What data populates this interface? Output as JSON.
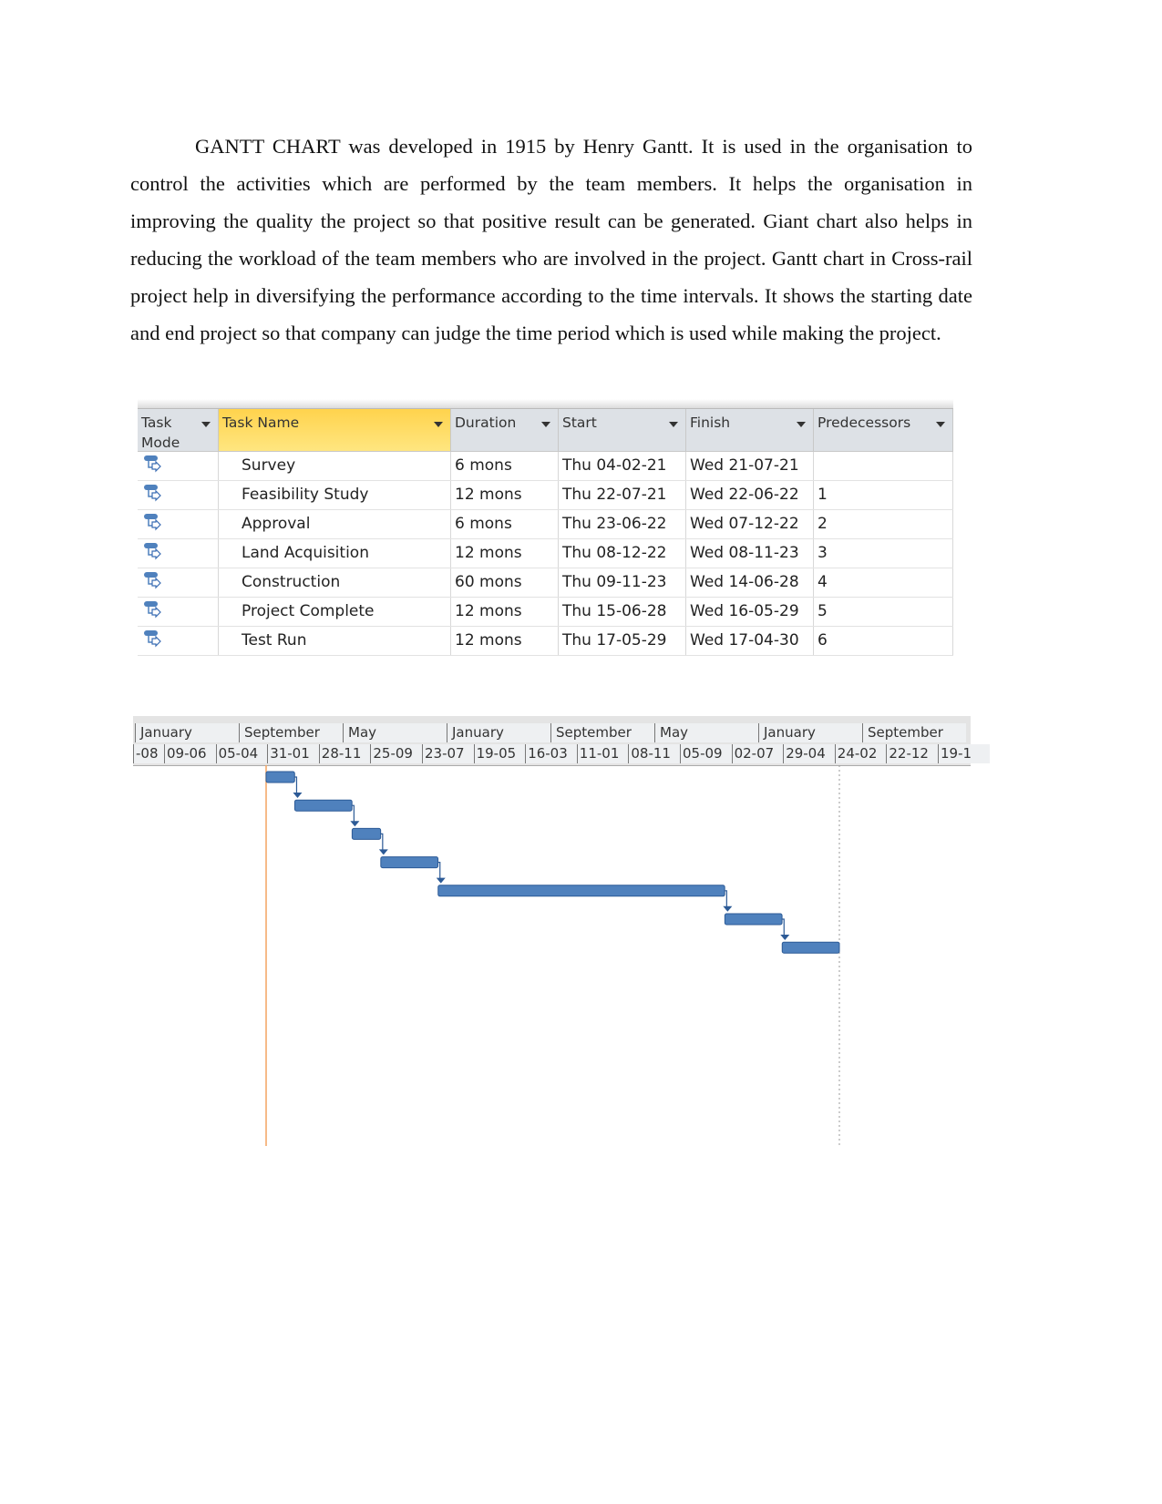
{
  "paragraph": "GANTT CHART was developed in 1915 by Henry Gantt. It is used in the organisation to control the activities which are performed by the team members. It helps the organisation in improving the quality the project so that positive result can be generated. Giant chart also helps in reducing the workload of the team members who are involved in the project. Gantt chart in Cross-rail project help in diversifying the performance according to the time intervals. It shows the starting date and end project so that company can judge the  time period which is used while making the project.",
  "table": {
    "headers": [
      "Task Mode",
      "Task Name",
      "Duration",
      "Start",
      "Finish",
      "Predecessors"
    ],
    "rows": [
      [
        "Survey",
        "6 mons",
        "Thu 04-02-21",
        "Wed 21-07-21",
        ""
      ],
      [
        "Feasibility Study",
        "12 mons",
        "Thu 22-07-21",
        "Wed 22-06-22",
        "1"
      ],
      [
        "Approval",
        "6 mons",
        "Thu 23-06-22",
        "Wed 07-12-22",
        "2"
      ],
      [
        "Land Acquisition",
        "12 mons",
        "Thu 08-12-22",
        "Wed 08-11-23",
        "3"
      ],
      [
        "Construction",
        "60 mons",
        "Thu 09-11-23",
        "Wed 14-06-28",
        "4"
      ],
      [
        "Project Complete",
        "12 mons",
        "Thu 15-06-28",
        "Wed 16-05-29",
        "5"
      ],
      [
        "Test Run",
        "12 mons",
        "Thu 17-05-29",
        "Wed 17-04-30",
        "6"
      ]
    ],
    "task_mode_icon": "auto-scheduled-task-icon",
    "header_highlight": "#ffd34d"
  },
  "gantt": {
    "top_tier": [
      "January",
      "September",
      "May",
      "January",
      "September",
      "May",
      "January",
      "September"
    ],
    "bottom_tier": [
      "-08",
      "09-06",
      "05-04",
      "31-01",
      "28-11",
      "25-09",
      "23-07",
      "19-05",
      "16-03",
      "11-01",
      "08-11",
      "05-09",
      "02-07",
      "29-04",
      "24-02",
      "22-12",
      "19-1"
    ],
    "tasks": [
      {
        "start": "2021-02-04",
        "finish": "2021-07-21"
      },
      {
        "start": "2021-07-22",
        "finish": "2022-06-22"
      },
      {
        "start": "2022-06-23",
        "finish": "2022-12-07"
      },
      {
        "start": "2022-12-08",
        "finish": "2023-11-08"
      },
      {
        "start": "2023-11-09",
        "finish": "2028-06-14"
      },
      {
        "start": "2028-06-15",
        "finish": "2029-05-16"
      },
      {
        "start": "2029-05-17",
        "finish": "2030-04-17"
      }
    ],
    "bar_color": "#4f81bd",
    "today_line_color": "#f4a460"
  }
}
